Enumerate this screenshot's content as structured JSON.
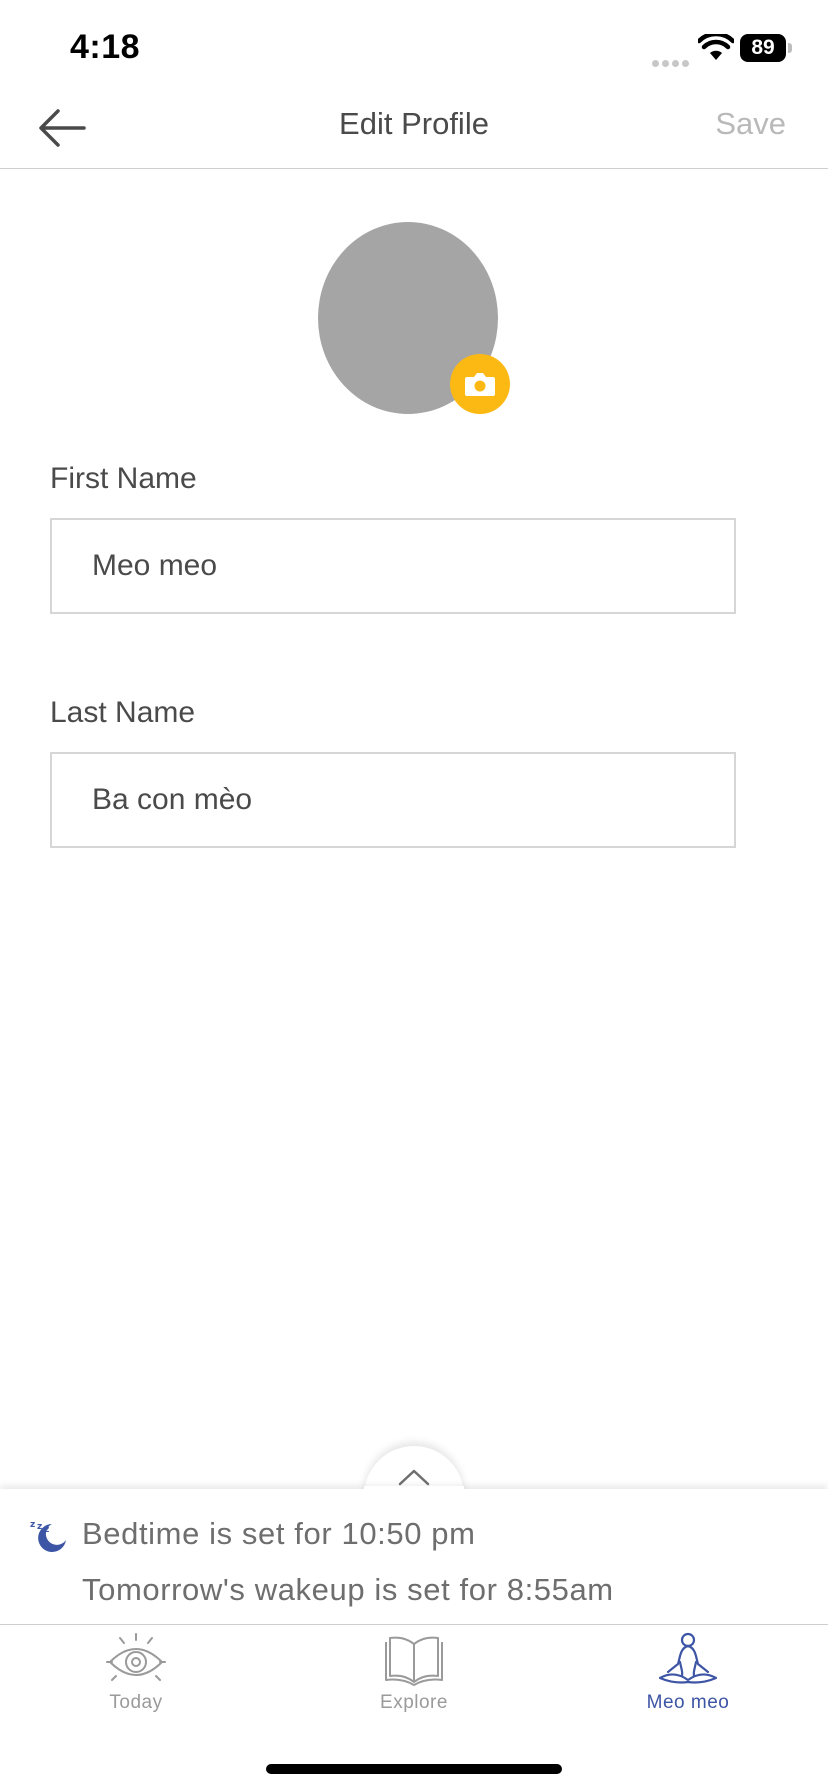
{
  "status_bar": {
    "time": "4:18",
    "battery": "89"
  },
  "nav": {
    "title": "Edit Profile",
    "save_label": "Save"
  },
  "form": {
    "first_name": {
      "label": "First Name",
      "value": "Meo meo"
    },
    "last_name": {
      "label": "Last Name",
      "value": "Ba con mèo"
    }
  },
  "sleep": {
    "bedtime": "Bedtime is set for 10:50 pm",
    "wakeup": "Tomorrow's wakeup is set for 8:55am"
  },
  "tabs": [
    {
      "label": "Today",
      "icon": "eye-icon",
      "active": false
    },
    {
      "label": "Explore",
      "icon": "book-icon",
      "active": false
    },
    {
      "label": "Meo meo",
      "icon": "meditation-icon",
      "active": true
    }
  ],
  "colors": {
    "accent": "#fdb913",
    "tab_active": "#3d55a5",
    "tab_inactive": "#9a9a9a",
    "avatar": "#a5a5a5"
  }
}
